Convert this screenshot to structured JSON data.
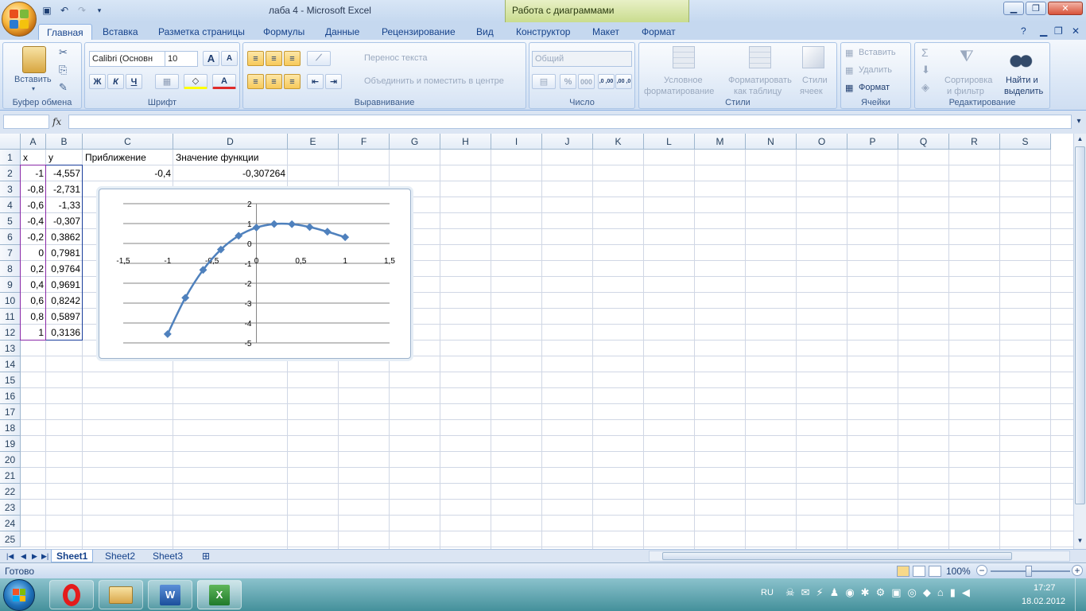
{
  "window": {
    "title": "лаба 4  -  Microsoft Excel",
    "context_group": "Работа с диаграммами"
  },
  "tabs": [
    {
      "label": "Главная",
      "active": true
    },
    {
      "label": "Вставка"
    },
    {
      "label": "Разметка страницы"
    },
    {
      "label": "Формулы"
    },
    {
      "label": "Данные"
    },
    {
      "label": "Рецензирование"
    },
    {
      "label": "Вид"
    },
    {
      "label": "Конструктор"
    },
    {
      "label": "Макет"
    },
    {
      "label": "Формат"
    }
  ],
  "ribbon": {
    "clipboard": {
      "label": "Буфер обмена",
      "paste": "Вставить"
    },
    "font": {
      "label": "Шрифт",
      "family": "Calibri (Основн",
      "size": "10",
      "bold": "Ж",
      "italic": "К",
      "underline": "Ч",
      "grow": "A",
      "shrink": "A",
      "fontcolor": "A"
    },
    "alignment": {
      "label": "Выравнивание",
      "wrap": "Перенос текста",
      "merge": "Объединить и поместить в центре"
    },
    "number": {
      "label": "Число",
      "format": "Общий",
      "percent": "%",
      "thousands": "000",
      "inc": ",0 ,00",
      "dec": ",00 ,0"
    },
    "styles": {
      "label": "Стили",
      "conditional_1": "Условное",
      "conditional_2": "форматирование",
      "table_1": "Форматировать",
      "table_2": "как таблицу",
      "cell_1": "Стили",
      "cell_2": "ячеек"
    },
    "cells": {
      "label": "Ячейки",
      "insert": "Вставить",
      "delete": "Удалить",
      "format": "Формат"
    },
    "editing": {
      "label": "Редактирование",
      "sort_1": "Сортировка",
      "sort_2": "и фильтр",
      "find_1": "Найти и",
      "find_2": "выделить",
      "sigma": "Σ"
    }
  },
  "formula_bar": {
    "fx": "fx",
    "name": "",
    "value": ""
  },
  "columns": [
    "A",
    "B",
    "C",
    "D",
    "E",
    "F",
    "G",
    "H",
    "I",
    "J",
    "K",
    "L",
    "M",
    "N",
    "O",
    "P",
    "Q",
    "R",
    "S"
  ],
  "rows": [
    "1",
    "2",
    "3",
    "4",
    "5",
    "6",
    "7",
    "8",
    "9",
    "10",
    "11",
    "12",
    "13",
    "14",
    "15",
    "16",
    "17",
    "18",
    "19",
    "20",
    "21",
    "22",
    "23",
    "24",
    "25"
  ],
  "cells": {
    "A1": "x",
    "B1": "y",
    "C1": "Приближение",
    "D1": "Значение функции",
    "C2": "-0,4",
    "D2": "-0,307264",
    "A2": "-1",
    "B2": "-4,557",
    "A3": "-0,8",
    "B3": "-2,731",
    "A4": "-0,6",
    "B4": "-1,33",
    "A5": "-0,4",
    "B5": "-0,307",
    "A6": "-0,2",
    "B6": "0,3862",
    "A7": "0",
    "B7": "0,7981",
    "A8": "0,2",
    "B8": "0,9764",
    "A9": "0,4",
    "B9": "0,9691",
    "A10": "0,6",
    "B10": "0,8242",
    "A11": "0,8",
    "B11": "0,5897",
    "A12": "1",
    "B12": "0,3136"
  },
  "chart_data": {
    "type": "scatter",
    "x": [
      -1,
      -0.8,
      -0.6,
      -0.4,
      -0.2,
      0,
      0.2,
      0.4,
      0.6,
      0.8,
      1
    ],
    "y": [
      -4.557,
      -2.731,
      -1.33,
      -0.307,
      0.3862,
      0.7981,
      0.9764,
      0.9691,
      0.8242,
      0.5897,
      0.3136
    ],
    "xlim": [
      -1.5,
      1.5
    ],
    "ylim": [
      -5,
      2
    ],
    "x_ticks": [
      "-1,5",
      "-1",
      "-0,5",
      "0",
      "0,5",
      "1",
      "1,5"
    ],
    "y_ticks": [
      "2",
      "1",
      "0",
      "-1",
      "-2",
      "-3",
      "-4",
      "-5"
    ],
    "grid": true,
    "color": "#4f81bd"
  },
  "sheets": [
    {
      "label": "Sheet1",
      "active": true
    },
    {
      "label": "Sheet2"
    },
    {
      "label": "Sheet3"
    }
  ],
  "status": {
    "ready": "Готово",
    "zoom": "100%"
  },
  "taskbar": {
    "lang": "RU",
    "time": "17:27",
    "date": "18.02.2012"
  }
}
